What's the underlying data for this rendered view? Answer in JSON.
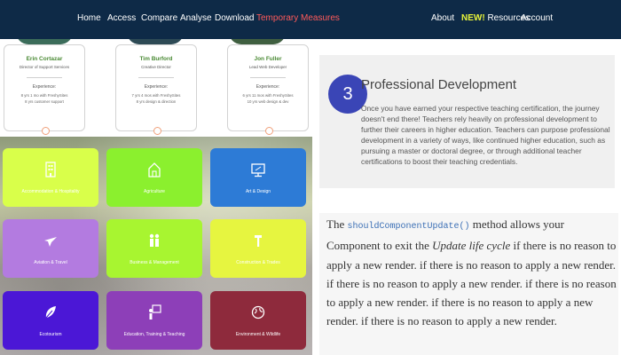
{
  "nav": {
    "left_items": [
      "Home",
      "Access",
      "Compare",
      "Analyse",
      "Download"
    ],
    "highlight_item": "Temporary Measures",
    "right_items": {
      "about": "About",
      "resources_prefix": "NEW!",
      "resources": " Resources",
      "account": "Account"
    }
  },
  "team": [
    {
      "name": "Erin Cortazar",
      "role": "Director of Support Services",
      "experience_label": "Experience:",
      "lines": [
        "8 yrs 1 mo with FreshySites",
        "8 yrs customer support"
      ]
    },
    {
      "name": "Tim Burford",
      "role": "Creative Director",
      "experience_label": "Experience:",
      "lines": [
        "7 yrs 4 mos with FreshySites",
        "8 yrs design & direction"
      ]
    },
    {
      "name": "Jon Fuller",
      "role": "Lead Web Developer",
      "experience_label": "Experience:",
      "lines": [
        "6 yrs 11 mos with FreshySites",
        "10 yrs web design & dev"
      ]
    }
  ],
  "categories": [
    {
      "label": "Accommodation & Hospitality",
      "color": "#d9ff4a",
      "icon": "building-icon"
    },
    {
      "label": "Agriculture",
      "color": "#8bf02e",
      "icon": "barn-icon"
    },
    {
      "label": "Art & Design",
      "color": "#2d7bd6",
      "icon": "monitor-icon"
    },
    {
      "label": "Aviation & Travel",
      "color": "#b37be0",
      "icon": "airplane-icon"
    },
    {
      "label": "Business & Management",
      "color": "#a8f530",
      "icon": "people-icon"
    },
    {
      "label": "Construction & Trades",
      "color": "#e6f540",
      "icon": "hammer-icon"
    },
    {
      "label": "Ecotourism",
      "color": "#4b17d6",
      "icon": "leaf-icon"
    },
    {
      "label": "Education, Training & Teaching",
      "color": "#8d3fb8",
      "icon": "teaching-icon"
    },
    {
      "label": "Environment & Wildlife",
      "color": "#8e2a3c",
      "icon": "globe-icon"
    }
  ],
  "professional": {
    "number": "3",
    "title": "Professional Development",
    "body": "Once you have earned your respective teaching certification, the journey doesn't end there! Teachers rely heavily on professional development to further their careers in higher education. Teachers can purpose professional development in a variety of ways, like continued higher education, such as pursuing a master or doctoral degree, or through additional teacher certifications to boost their teaching credentials."
  },
  "code_note": {
    "prefix": "The ",
    "code": "shouldComponentUpdate()",
    "mid": " method allows your Component to exit the ",
    "emph": "Update life cycle",
    "rest": " if there is no reason to apply a new render. if there is no reason to apply a new render. if there is no reason to apply a new render. if there is no reason to apply a new render. if there is no reason to apply a new render. if there is no reason to apply a new render."
  },
  "colors": {
    "nav_bg": "#0e2a47",
    "highlight": "#ff5a5a",
    "new_badge": "#e6f23a",
    "accent_name": "#4a8a34",
    "step_circle": "#3a45b6",
    "code_border": "#9ad58d"
  }
}
